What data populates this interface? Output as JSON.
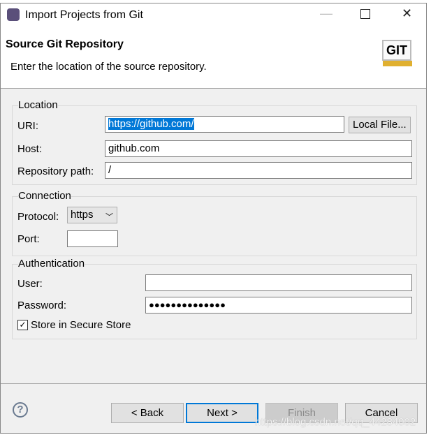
{
  "window": {
    "title": "Import Projects from Git"
  },
  "header": {
    "title": "Source Git Repository",
    "description": "Enter the location of the source repository.",
    "git_logo": "GIT"
  },
  "location": {
    "group_label": "Location",
    "uri_label": "URI:",
    "uri_value": "https://github.com/",
    "local_file_button": "Local File...",
    "host_label": "Host:",
    "host_value": "github.com",
    "repo_path_label": "Repository path:",
    "repo_path_value": "/"
  },
  "connection": {
    "group_label": "Connection",
    "protocol_label": "Protocol:",
    "protocol_value": "https",
    "port_label": "Port:",
    "port_value": ""
  },
  "authentication": {
    "group_label": "Authentication",
    "user_label": "User:",
    "user_value": "",
    "password_label": "Password:",
    "password_value": "●●●●●●●●●●●●●●",
    "store_label": "Store in Secure Store",
    "store_checked": true
  },
  "buttons": {
    "back": "< Back",
    "next": "Next >",
    "finish": "Finish",
    "cancel": "Cancel"
  },
  "watermark": "https://blog.csdn.net/qq_44284002"
}
